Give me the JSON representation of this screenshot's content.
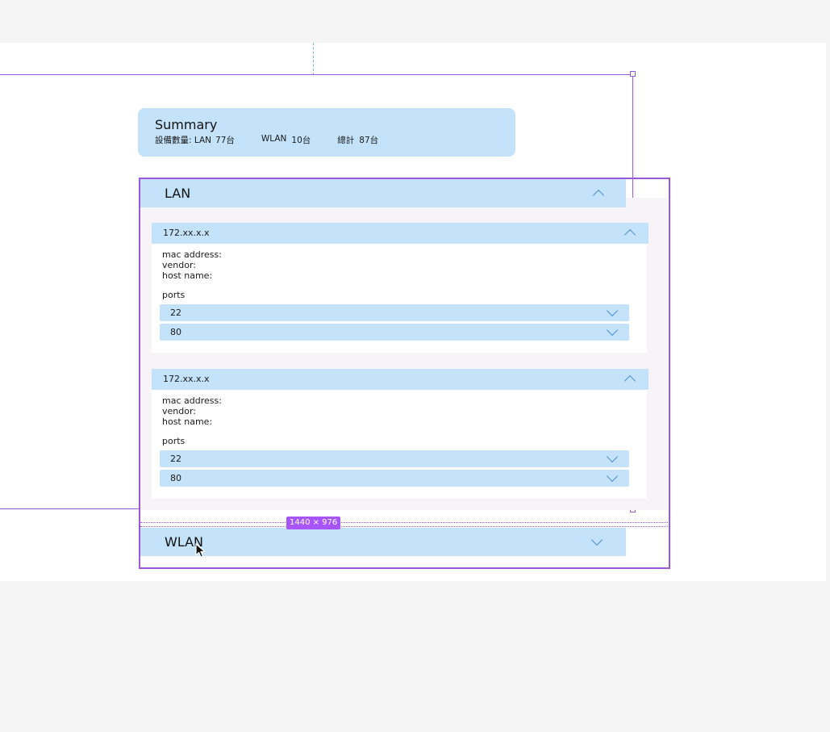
{
  "summary": {
    "title": "Summary",
    "stats": {
      "label": "設備數量: LAN",
      "lan_count": "77台",
      "wlan_label": "WLAN",
      "wlan_count": "10台",
      "total_label": "總計",
      "total_count": "87台"
    }
  },
  "lan": {
    "title": "LAN",
    "hosts": [
      {
        "ip": "172.xx.x.x",
        "mac_label": "mac address:",
        "vendor_label": "vendor:",
        "host_label": "host name:",
        "ports_label": "ports",
        "ports": [
          "22",
          "80"
        ]
      },
      {
        "ip": "172.xx.x.x",
        "mac_label": "mac address:",
        "vendor_label": "vendor:",
        "host_label": "host name:",
        "ports_label": "ports",
        "ports": [
          "22",
          "80"
        ]
      }
    ]
  },
  "wlan": {
    "title": "WLAN"
  },
  "selection": {
    "dimensions": "1440 × 976"
  },
  "icons": {
    "expand": "chevron-down-icon",
    "collapse": "chevron-up-icon",
    "cursor": "mouse-pointer-icon"
  },
  "colors": {
    "panel_fill": "#c4e3fa",
    "selection": "#9b59d9",
    "chevron": "#4d8fd1"
  }
}
